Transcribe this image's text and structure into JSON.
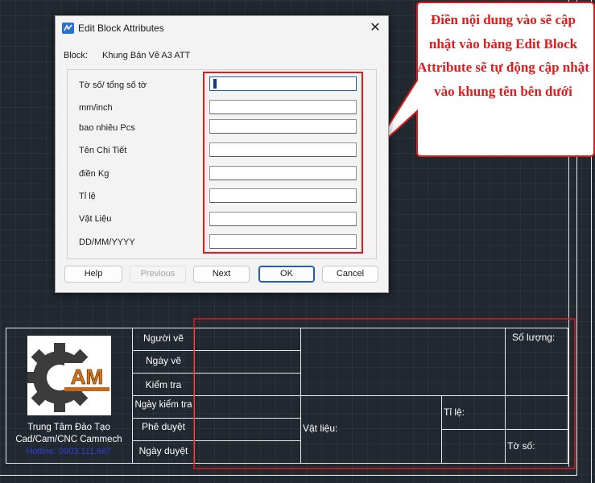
{
  "dialog": {
    "title": "Edit Block Attributes",
    "close_glyph": "✕",
    "block_label": "Block:",
    "block_name": "Khung Bản Vẽ A3 ATT",
    "attributes": [
      {
        "label": "Tờ số/ tổng số tờ",
        "value": ""
      },
      {
        "label": "mm/inch",
        "value": ""
      },
      {
        "label": "bao nhiêu Pcs",
        "value": ""
      },
      {
        "label": "Tên Chi Tiết",
        "value": ""
      },
      {
        "label": "điền Kg",
        "value": ""
      },
      {
        "label": "Tỉ lệ",
        "value": ""
      },
      {
        "label": "Vật Liệu",
        "value": ""
      },
      {
        "label": "DD/MM/YYYY",
        "value": ""
      }
    ],
    "buttons": {
      "help": "Help",
      "previous": "Previous",
      "next": "Next",
      "ok": "OK",
      "cancel": "Cancel"
    }
  },
  "callout": {
    "text": "Điền nội dung vào sẽ cập nhật vào bảng Edit Block Attribute sẽ tự động cập nhật vào khung tên bên dưới",
    "color": "#e31a1a"
  },
  "title_block": {
    "logo_text": "AM",
    "company_line1": "Trung Tâm Đào Tạo",
    "company_line2": "Cad/Cam/CNC Cammech",
    "hotline": "Hotline: 0903.111.667",
    "rows": [
      "Người vẽ",
      "Ngày vẽ",
      "Kiểm tra",
      "Ngày kiểm tra",
      "Phê duyệt",
      "Ngày duyệt"
    ],
    "so_luong": "Số lượng:",
    "vat_lieu": "Vật liệu:",
    "ti_le": "Tỉ lệ:",
    "to_so": "Tờ số:"
  },
  "colors": {
    "canvas": "#212830",
    "frame": "#e9e9e9",
    "highlight": "#e31a1a",
    "dialog": "#f3f3f3",
    "hotline": "#2f3fd8"
  },
  "icons": {
    "app": "app-logo-icon",
    "close": "close-icon"
  }
}
